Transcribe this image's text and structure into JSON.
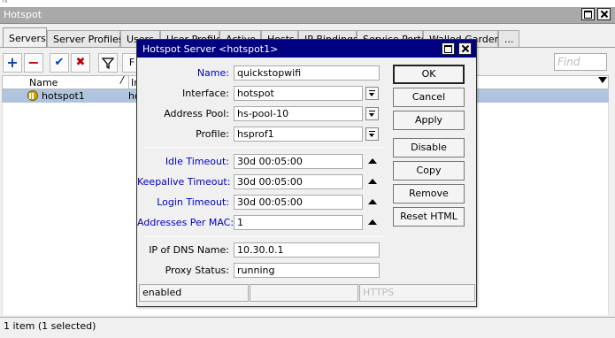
{
  "outer": {
    "top_strip": "N",
    "title": "Hotspot",
    "tabs": [
      "Servers",
      "Server Profiles",
      "Users",
      "User Profiles",
      "Active",
      "Hosts",
      "IP Bindings",
      "Service Ports",
      "Walled Garden",
      "..."
    ],
    "find_placeholder": "Find",
    "columns": [
      "Name",
      "In"
    ],
    "rows": [
      {
        "name": "hotspot1",
        "interface": "ho"
      }
    ],
    "toolbar": {
      "add": "+",
      "remove": "−",
      "enable": "✔",
      "disable": "✖",
      "filter": "filter-icon",
      "extra": "F"
    },
    "status": "1 item (1 selected)"
  },
  "dialog": {
    "title": "Hotspot Server <hotspot1>",
    "fields": {
      "name": {
        "label": "Name:",
        "value": "quickstopwifi"
      },
      "interface": {
        "label": "Interface:",
        "value": "hotspot"
      },
      "address_pool": {
        "label": "Address Pool:",
        "value": "hs-pool-10"
      },
      "profile": {
        "label": "Profile:",
        "value": "hsprof1"
      },
      "idle_timeout": {
        "label": "Idle Timeout:",
        "value": "30d 00:05:00"
      },
      "keepalive_timeout": {
        "label": "Keepalive Timeout:",
        "value": "30d 00:05:00"
      },
      "login_timeout": {
        "label": "Login Timeout:",
        "value": "30d 00:05:00"
      },
      "addresses_per_mac": {
        "label": "Addresses Per MAC:",
        "value": "1"
      },
      "ip_of_dns_name": {
        "label": "IP of DNS Name:",
        "value": "10.30.0.1"
      },
      "proxy_status": {
        "label": "Proxy Status:",
        "value": "running"
      }
    },
    "buttons": {
      "ok": "OK",
      "cancel": "Cancel",
      "apply": "Apply",
      "disable": "Disable",
      "copy": "Copy",
      "remove": "Remove",
      "reset_html": "Reset HTML"
    },
    "status": {
      "state": "enabled",
      "middle": "",
      "https": "HTTPS"
    }
  },
  "colors": {
    "dialog_titlebar": "#000080",
    "selected_row": "#b0c4de",
    "blue_label": "#0000c0",
    "outer_titlebar": "#a9a9a9"
  }
}
